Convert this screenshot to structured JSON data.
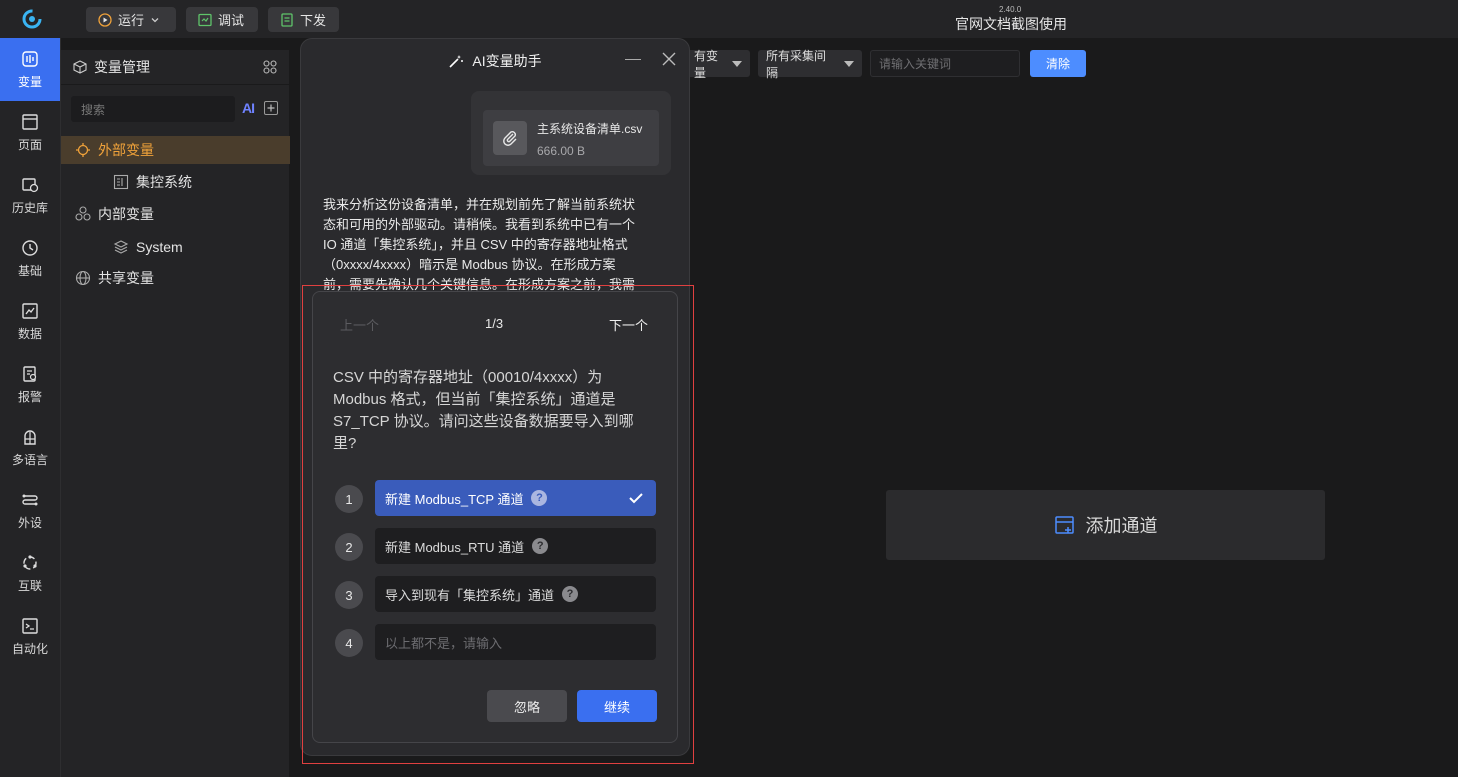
{
  "topbar": {
    "run_label": "运行",
    "debug_label": "调试",
    "deploy_label": "下发",
    "version": "2.40.0",
    "title": "官网文档截图使用"
  },
  "nav": [
    {
      "label": "变量",
      "icon": "variable-icon",
      "active": true
    },
    {
      "label": "页面",
      "icon": "page-icon"
    },
    {
      "label": "历史库",
      "icon": "history-db-icon"
    },
    {
      "label": "基础",
      "icon": "basic-icon"
    },
    {
      "label": "数据",
      "icon": "data-icon"
    },
    {
      "label": "报警",
      "icon": "alarm-icon"
    },
    {
      "label": "多语言",
      "icon": "language-icon"
    },
    {
      "label": "外设",
      "icon": "peripheral-icon"
    },
    {
      "label": "互联",
      "icon": "interconnect-icon"
    },
    {
      "label": "自动化",
      "icon": "automation-icon"
    }
  ],
  "var_panel": {
    "title": "变量管理",
    "search_placeholder": "搜索",
    "ai_label": "AI",
    "tree": [
      {
        "label": "外部变量",
        "selected": true
      },
      {
        "label": "集控系统"
      },
      {
        "label": "内部变量"
      },
      {
        "label": "System"
      },
      {
        "label": "共享变量"
      }
    ]
  },
  "filters": {
    "var_filter": "有变量",
    "interval_filter": "所有采集间隔",
    "keyword_placeholder": "请输入关键词",
    "clear_label": "清除"
  },
  "add_channel_label": "添加通道",
  "assistant": {
    "title": "AI变量助手",
    "file": {
      "name": "主系统设备清单.csv",
      "size": "666.00 B"
    },
    "message_lines": [
      "我来分析这份设备清单，并在规划前先了解当前系统状",
      "态和可用的外部驱动。请稍候。我看到系统中已有一个",
      "IO 通道「集控系统」，并且 CSV 中的寄存器地址格式",
      "（0xxxx/4xxxx）暗示是 Modbus 协议。在形成方案",
      "前，需要先确认几个关键信息。在形成方案之前，我需"
    ],
    "question": {
      "prev_label": "上一个",
      "page": "1/3",
      "next_label": "下一个",
      "text": "CSV 中的寄存器地址（00010/4xxxx）为 Modbus 格式，但当前「集控系统」通道是 S7_TCP 协议。请问这些设备数据要导入到哪里?",
      "options": [
        {
          "num": "1",
          "label": "新建 Modbus_TCP 通道",
          "selected": true
        },
        {
          "num": "2",
          "label": "新建 Modbus_RTU 通道"
        },
        {
          "num": "3",
          "label": "导入到现有「集控系统」通道"
        },
        {
          "num": "4",
          "placeholder": "以上都不是，请输入"
        }
      ],
      "ignore_label": "忽略",
      "continue_label": "继续"
    }
  },
  "colors": {
    "accent": "#3a6ff0",
    "selected_tree": "#f0a23a",
    "highlight_border": "#e04040"
  }
}
